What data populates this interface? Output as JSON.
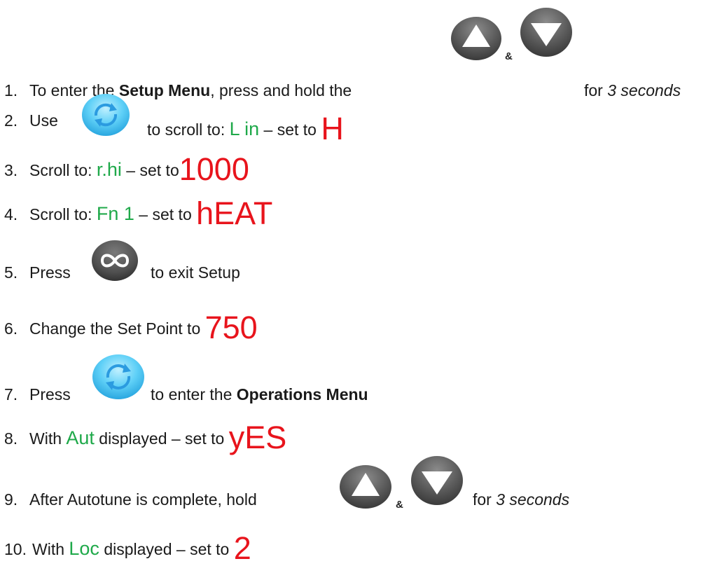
{
  "steps": [
    {
      "num": "1.",
      "pre": "To enter the ",
      "bold": "Setup Menu",
      "post": ", press and hold the",
      "amp": "&",
      "tail": "for ",
      "ital": "3 seconds"
    },
    {
      "num": "2.",
      "pre": "Use",
      "mid": "to scroll to:  ",
      "code": "L in",
      "post": " – set to ",
      "val": "H"
    },
    {
      "num": "3.",
      "pre": "Scroll to: ",
      "code": "r.hi",
      "post": " – set to",
      "val": "1000"
    },
    {
      "num": "4.",
      "pre": "Scroll to: ",
      "code": "Fn 1",
      "post": " – set to ",
      "val": "hEAT"
    },
    {
      "num": "5.",
      "pre": "Press",
      "post": "to exit Setup"
    },
    {
      "num": "6.",
      "pre": "Change the Set Point to ",
      "val": "750"
    },
    {
      "num": "7.",
      "pre": "Press",
      "post": "to enter the ",
      "bold": "Operations Menu"
    },
    {
      "num": "8.",
      "pre": "With ",
      "code": "Aut",
      "post": " displayed – set to ",
      "val": "yES"
    },
    {
      "num": "9.",
      "pre": "After Autotune is complete, hold",
      "amp": "&",
      "tail": "for ",
      "ital": "3 seconds"
    },
    {
      "num": "10.",
      "pre": "With ",
      "code": "Loc",
      "post": " displayed – set to ",
      "val": "2"
    }
  ],
  "icons": {
    "up": "up-arrow-icon",
    "down": "down-arrow-icon",
    "scroll": "scroll-cycle-icon",
    "exit": "infinity-icon"
  },
  "colors": {
    "code": "#1fa94a",
    "value": "#e8141c",
    "button_grey": "#595959",
    "scroll_blue": "#3fb8ef"
  }
}
